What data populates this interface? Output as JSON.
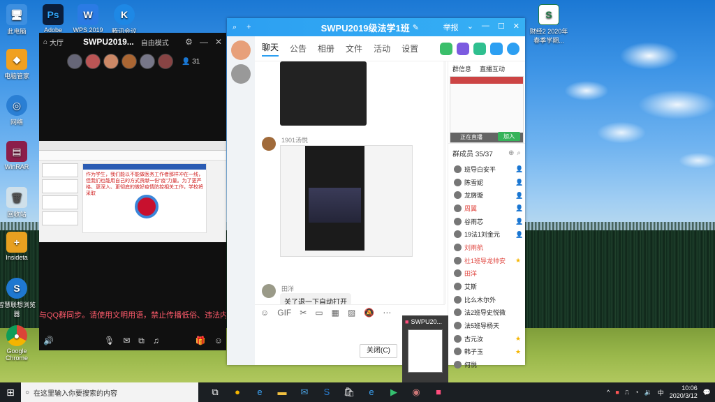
{
  "desktop": {
    "icons": [
      {
        "label": "此电脑",
        "icon": "computer-icon",
        "color": "#3d8fe0"
      },
      {
        "label": "Adobe",
        "icon": "photoshop-icon",
        "color": "#0b1e3b"
      },
      {
        "label": "WPS 2019",
        "icon": "wps-icon",
        "color": "#2b7be4"
      },
      {
        "label": "腾讯会议",
        "icon": "meeting-icon",
        "color": "#1e88e5"
      },
      {
        "label": "电脑管家",
        "icon": "shield-icon",
        "color": "#f0a020"
      },
      {
        "label": "网络",
        "icon": "network-icon",
        "color": "#2a7fd4"
      },
      {
        "label": "WinRAR",
        "icon": "winrar-icon",
        "color": "#8b1e4a"
      },
      {
        "label": "回收站",
        "icon": "recycle-bin-icon",
        "color": "#cfe0ea"
      },
      {
        "label": "Insideta",
        "icon": "insideta-icon",
        "color": "#e8a020"
      },
      {
        "label": "智慧联想浏览器",
        "icon": "lenovo-browser-icon",
        "color": "#1f78d1"
      },
      {
        "label": "Google Chrome",
        "icon": "chrome-icon",
        "color": "#db4437"
      },
      {
        "label": "财经2 2020年春季学期...",
        "icon": "excel-file-icon",
        "color": "#1d7a45"
      }
    ]
  },
  "video_window": {
    "nav": "大厅",
    "title": "SWPU2019...",
    "mode": "自由模式",
    "member_count": "31",
    "marquee": "与QQ群同步。请使用文明用语，禁止传播低俗、违法内容",
    "slide_text": "作为学生，我们能以不能做医务工作者那样冲在一线，但我们也能用自己的方式贡献一份“疫”力量。为了更严格、更深入、更彻底的做好疫情防控相关工作，学校将采取"
  },
  "qq": {
    "title": "SWPU2019级法学1班",
    "title_controls": {
      "group": "举报"
    },
    "tabs": [
      "聊天",
      "公告",
      "相册",
      "文件",
      "活动",
      "设置"
    ],
    "chat": {
      "sender1": "1901汤悦",
      "sender2": "田洋",
      "message": "关了退一下自动打开"
    },
    "close_button": "关闭(C)",
    "right": {
      "tab_info": "群信息",
      "tab_live": "直播互动",
      "live_caption": "正在直播",
      "join": "加入",
      "members_label": "群成员 35/37",
      "members": [
        {
          "name": "班导白安平",
          "color": "#222",
          "badge": "admin"
        },
        {
          "name": "陈雪妮",
          "color": "#222",
          "badge": "admin"
        },
        {
          "name": "龙旖璇",
          "color": "#222",
          "badge": "admin"
        },
        {
          "name": "周翼",
          "color": "#e0463f",
          "badge": "admin"
        },
        {
          "name": "谷雨芯",
          "color": "#222",
          "badge": "admin"
        },
        {
          "name": "19法1刘金元",
          "color": "#222",
          "badge": "admin"
        },
        {
          "name": "刘雨航",
          "color": "#e0463f",
          "badge": ""
        },
        {
          "name": "社1班导龙帅安",
          "color": "#e0463f",
          "badge": "star"
        },
        {
          "name": "田洋",
          "color": "#e0463f",
          "badge": ""
        },
        {
          "name": "艾斯",
          "color": "#222",
          "badge": ""
        },
        {
          "name": "比么木尔外",
          "color": "#222",
          "badge": ""
        },
        {
          "name": "法2班导史悦微",
          "color": "#222",
          "badge": ""
        },
        {
          "name": "法5班导杨天",
          "color": "#222",
          "badge": ""
        },
        {
          "name": "古元汝",
          "color": "#222",
          "badge": "star"
        },
        {
          "name": "韩子玉",
          "color": "#222",
          "badge": "star"
        },
        {
          "name": "何悦",
          "color": "#222",
          "badge": ""
        }
      ]
    }
  },
  "preview": {
    "title": "SWPU20..."
  },
  "taskbar": {
    "search_placeholder": "在这里输入你要搜索的内容",
    "time": "10:06",
    "date": "2020/3/12",
    "ime": "中"
  }
}
